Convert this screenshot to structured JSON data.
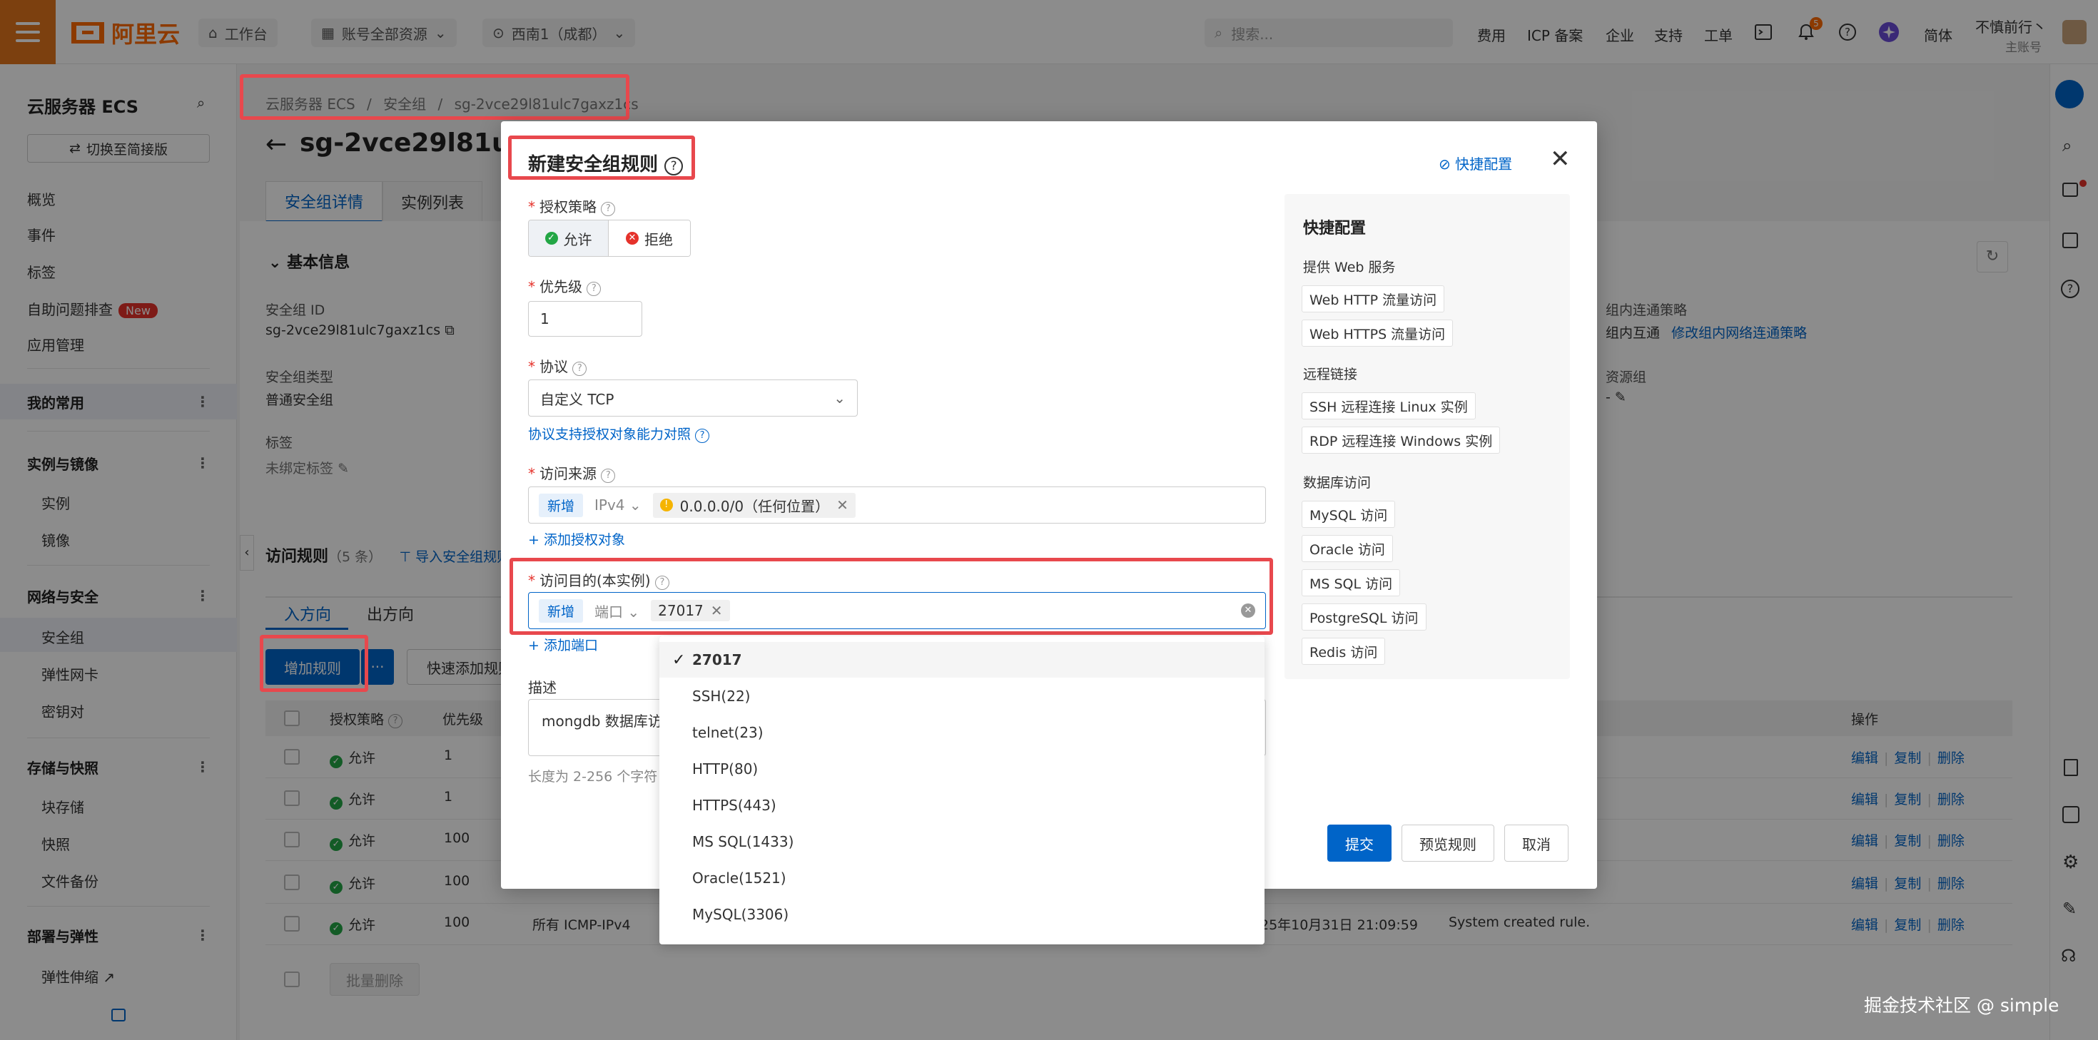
{
  "topbar": {
    "logo_text": "阿里云",
    "workbench": "工作台",
    "resource_scope": "账号全部资源",
    "region": "西南1（成都）",
    "search_placeholder": "搜索...",
    "links": [
      "费用",
      "ICP 备案",
      "企业",
      "支持",
      "工单"
    ],
    "notification_count": "5",
    "language": "简体",
    "user_name": "不慎前行丶",
    "user_role": "主账号"
  },
  "sidebar": {
    "title": "云服务器 ECS",
    "switch_label": "切换至简接版",
    "top_items": [
      "概览",
      "事件",
      "标签",
      "自助问题排查",
      "应用管理"
    ],
    "new_badge": "New",
    "favorites": "我的常用",
    "groups": [
      {
        "title": "实例与镜像",
        "items": [
          "实例",
          "镜像"
        ]
      },
      {
        "title": "网络与安全",
        "items": [
          "安全组",
          "弹性网卡",
          "密钥对"
        ]
      },
      {
        "title": "存储与快照",
        "items": [
          "块存储",
          "快照",
          "文件备份"
        ]
      },
      {
        "title": "部署与弹性",
        "items": [
          "弹性伸缩"
        ]
      }
    ]
  },
  "page": {
    "breadcrumb": [
      "云服务器 ECS",
      "安全组",
      "sg-2vce29l81ulc7gaxz1cs"
    ],
    "title": "sg-2vce29l81ul",
    "tabs": [
      "安全组详情",
      "实例列表"
    ],
    "basic_info": "基本信息",
    "sg_id_label": "安全组 ID",
    "sg_id": "sg-2vce29l81ulc7gaxz1cs",
    "sg_type_label": "安全组类型",
    "sg_type": "普通安全组",
    "tag_label": "标签",
    "tag_value": "未绑定标签",
    "intra_label": "组内连通策略",
    "intra_value": "组内互通",
    "intra_link": "修改组内网络连通策略",
    "rg_label": "资源组",
    "rg_value": "-",
    "rules_title": "访问规则",
    "rules_count": "（5 条）",
    "import_link": "导入安全组规则",
    "direction_tabs": [
      "入方向",
      "出方向"
    ],
    "add_rule": "增加规则",
    "more": "···",
    "quick_add": "快速添加规则",
    "columns": [
      "授权策略",
      "优先级",
      "操作"
    ],
    "rows": [
      {
        "policy": "允许",
        "priority": "1"
      },
      {
        "policy": "允许",
        "priority": "1"
      },
      {
        "policy": "允许",
        "priority": "100"
      },
      {
        "policy": "允许",
        "priority": "100"
      },
      {
        "policy": "允许",
        "priority": "100",
        "protocol": "所有 ICMP-IPv4",
        "time": "25年10月31日 21:09:59",
        "desc": "System created rule."
      }
    ],
    "row_actions": [
      "编辑",
      "复制",
      "删除"
    ],
    "batch_delete": "批量删除"
  },
  "modal": {
    "title": "新建安全组规则",
    "quick_config_link": "快捷配置",
    "policy_label": "授权策略",
    "policy_allow": "允许",
    "policy_deny": "拒绝",
    "priority_label": "优先级",
    "priority_value": "1",
    "protocol_label": "协议",
    "protocol_value": "自定义 TCP",
    "protocol_help": "协议支持授权对象能力对照",
    "source_label": "访问来源",
    "source_tag": "新增",
    "source_type": "IPv4",
    "source_value": "0.0.0.0/0（任何位置）",
    "add_source": "添加授权对象",
    "dest_label": "访问目的(本实例)",
    "dest_tag": "新增",
    "dest_type": "端口",
    "dest_value": "27017",
    "add_port": "添加端口",
    "desc_label": "描述",
    "desc_value": "mongdb 数据库访问",
    "desc_hint": "长度为 2-256 个字符",
    "submit": "提交",
    "preview": "预览规则",
    "cancel": "取消"
  },
  "quick_panel": {
    "title": "快捷配置",
    "sections": [
      {
        "title": "提供 Web 服务",
        "items": [
          "Web HTTP 流量访问",
          "Web HTTPS 流量访问"
        ]
      },
      {
        "title": "远程链接",
        "items": [
          "SSH 远程连接 Linux 实例",
          "RDP 远程连接 Windows 实例"
        ]
      },
      {
        "title": "数据库访问",
        "items": [
          "MySQL 访问",
          "Oracle 访问",
          "MS SQL 访问",
          "PostgreSQL 访问",
          "Redis 访问"
        ]
      }
    ]
  },
  "dropdown": {
    "options": [
      "27017",
      "SSH(22)",
      "telnet(23)",
      "HTTP(80)",
      "HTTPS(443)",
      "MS SQL(1433)",
      "Oracle(1521)",
      "MySQL(3306)"
    ]
  },
  "watermark": "掘金技术社区 @ simple",
  "colors": {
    "brand": "#ff6a00",
    "primary": "#0064c8",
    "highlight": "#e8484d"
  }
}
